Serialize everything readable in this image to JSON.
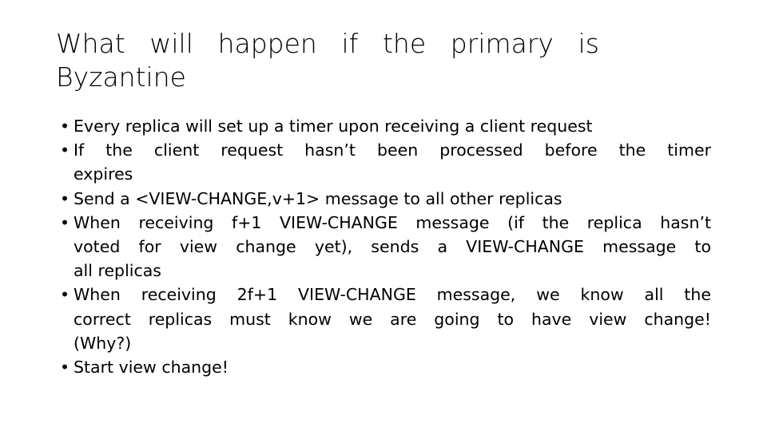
{
  "slide": {
    "background_color": "#ffffff",
    "text_color": "#000000",
    "title": {
      "full": "What will happen if the primary is Byzantine",
      "lines": [
        "What will happen if the primary is",
        "Byzantine"
      ]
    },
    "bullet_marker": "•",
    "bullets": [
      {
        "full": "Every replica will set up a timer upon receiving a client request",
        "lines": [
          "Every replica will set up a timer upon receiving a client request"
        ]
      },
      {
        "full": "If the client request hasn’t been processed before the timer expires",
        "lines": [
          "If the client request hasn’t been processed before the timer",
          "expires"
        ]
      },
      {
        "full": "Send a <VIEW-CHANGE,v+1> message to all other replicas",
        "lines": [
          "Send a <VIEW-CHANGE,v+1> message to all other replicas"
        ]
      },
      {
        "full": "When receiving f+1 VIEW-CHANGE message (if the replica hasn’t voted for view change yet), sends a VIEW-CHANGE message to all replicas",
        "lines": [
          "When receiving f+1 VIEW-CHANGE message (if the replica hasn’t",
          "voted for view change yet), sends a VIEW-CHANGE message to",
          "all replicas"
        ]
      },
      {
        "full": "When receiving 2f+1 VIEW-CHANGE message, we know all the correct replicas must know we are going to have view change! (Why?)",
        "lines": [
          "When receiving 2f+1 VIEW-CHANGE message, we know all the",
          "correct replicas must know we are going to have view change!",
          "(Why?)"
        ]
      },
      {
        "full": "Start view change!",
        "lines": [
          "Start view change!"
        ]
      }
    ]
  }
}
